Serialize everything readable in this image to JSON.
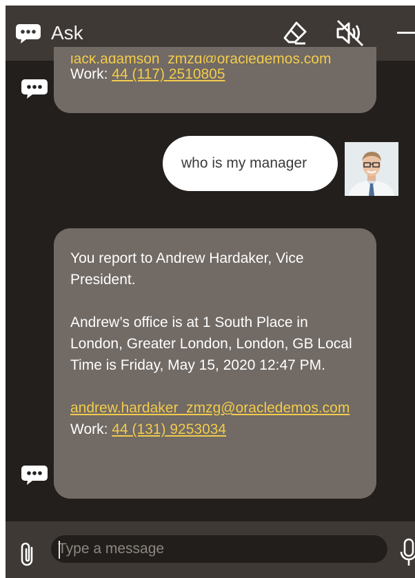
{
  "header": {
    "title": "Ask",
    "icons": [
      "chat-bubble-icon",
      "eraser-icon",
      "mute-icon",
      "minimize-icon"
    ]
  },
  "messages": {
    "first": {
      "email_partial": "jack.adamson_zmzg@oracledemos.com",
      "work_label": "Work:",
      "work_phone": "44 (117) 2510805"
    },
    "user": {
      "text": "who is my manager"
    },
    "second": {
      "line1": "You report to Andrew Hardaker, Vice President.",
      "line2": "Andrew’s office is at 1 South Place in London, Greater London, London, GB Local Time is Friday, May 15, 2020 12:47 PM.",
      "email": "andrew.hardaker_zmzg@oracledemos.com",
      "work_label": "Work:",
      "work_phone": "44 (131) 9253034"
    }
  },
  "composer": {
    "placeholder": "Type a message"
  },
  "colors": {
    "background": "#231f1c",
    "header": "#3e3935",
    "bot_bubble": "#716a65",
    "link": "#f3cc4b",
    "user_bubble": "#ffffff"
  }
}
